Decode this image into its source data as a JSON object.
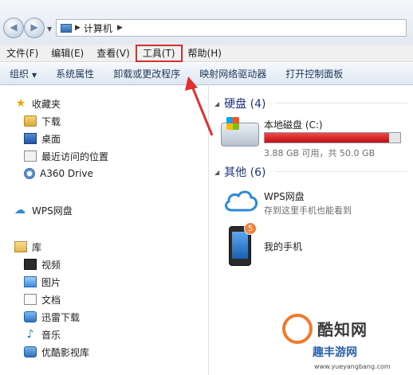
{
  "address": {
    "location": "计算机"
  },
  "menu": [
    "文件(F)",
    "编辑(E)",
    "查看(V)",
    "工具(T)",
    "帮助(H)"
  ],
  "menu_highlight_index": 3,
  "commands": {
    "organize": "组织",
    "items": [
      "系统属性",
      "卸载或更改程序",
      "映射网络驱动器",
      "打开控制面板"
    ]
  },
  "nav": {
    "favorites": "收藏夹",
    "favorites_items": [
      "下载",
      "桌面",
      "最近访问的位置",
      "A360 Drive"
    ],
    "wps": "WPS网盘",
    "library": "库",
    "library_items": [
      "视频",
      "图片",
      "文档",
      "迅雷下载",
      "音乐",
      "优酷影视库"
    ]
  },
  "content": {
    "disk_group": "硬盘 (4)",
    "drive_name": "本地磁盘 (C:)",
    "drive_used_fraction": 0.92,
    "drive_meta": "3.88 GB 可用，共 50.0 GB",
    "other_group": "其他 (6)",
    "wps_name": "WPS网盘",
    "wps_sub": "存到这里手机也能看到",
    "phone_name": "我的手机",
    "phone_badge": "5"
  },
  "watermark": {
    "brand": "酷知网",
    "brand2": "趣丰游网",
    "url": "www.yueyangbang.com"
  },
  "colors": {
    "highlight": "#d5302d",
    "drive_fill": "#c20e0e",
    "group_header": "#1e3287"
  }
}
